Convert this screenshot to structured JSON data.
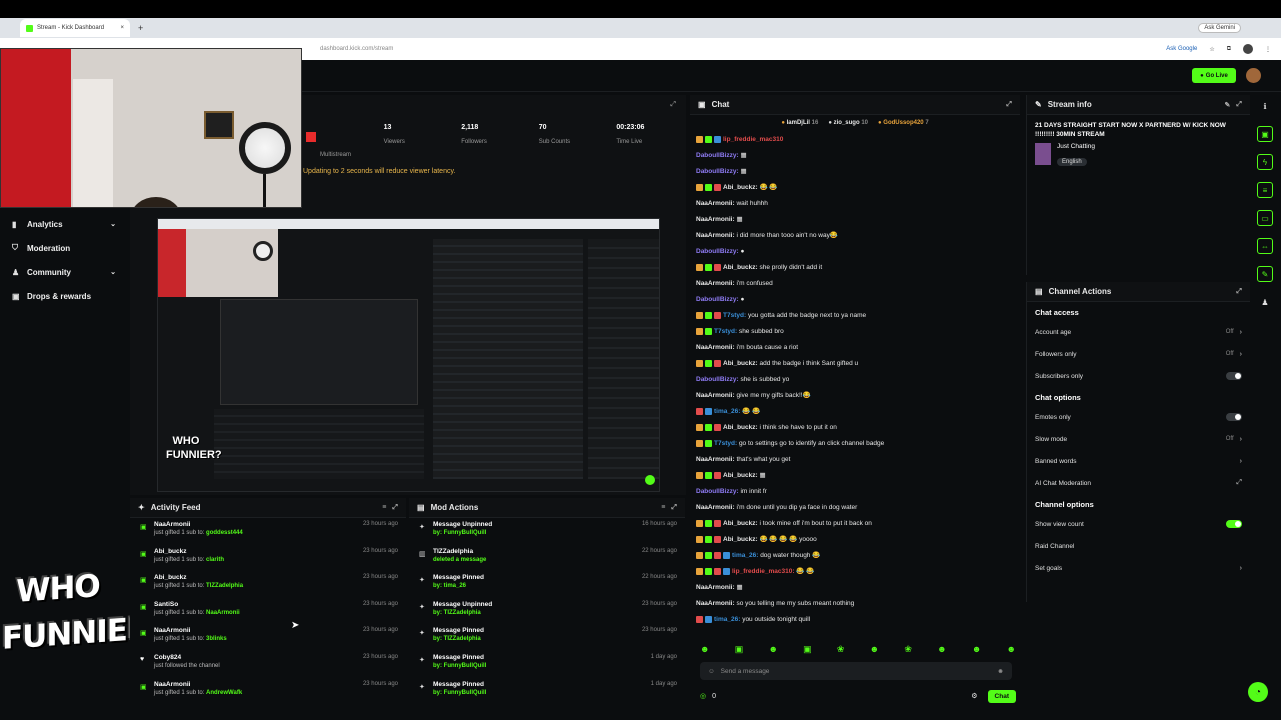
{
  "browser": {
    "tab_title": "Stream - Kick Dashboard",
    "tab_close": "×",
    "new_tab": "+",
    "gemini": "Ask Gemini",
    "url": "dashboard.kick.com/stream",
    "ask_google": "Ask Google"
  },
  "appbar": {
    "go_live": "Go Live"
  },
  "sidebar": {
    "items": [
      {
        "label": "Analytics",
        "icon": "chart-icon",
        "chevron": "⌄"
      },
      {
        "label": "Moderation",
        "icon": "shield-icon"
      },
      {
        "label": "Community",
        "icon": "people-icon",
        "chevron": "⌄"
      },
      {
        "label": "Drops & rewards",
        "icon": "gift-icon"
      }
    ]
  },
  "logo_text": "WHO FUNNIER?",
  "stats": {
    "multistream_label": "Multistream",
    "items": [
      {
        "value": "13",
        "label": "Viewers"
      },
      {
        "value": "2,118",
        "label": "Followers"
      },
      {
        "value": "70",
        "label": "Sub Counts"
      },
      {
        "value": "00:23:06",
        "label": "Time Live"
      }
    ],
    "warning": "Updating to 2 seconds will reduce viewer latency."
  },
  "preview": {
    "logo": "WHO FUNNIER?"
  },
  "activity_feed": {
    "title": "Activity Feed",
    "items": [
      {
        "who": "NaaArmonii",
        "action": "just gifted 1 sub to:",
        "target": "goddesst444",
        "time": "23 hours ago",
        "icon": "gift-icon"
      },
      {
        "who": "Abi_buckz",
        "action": "just gifted 1 sub to:",
        "target": "clarith",
        "time": "23 hours ago",
        "icon": "gift-icon"
      },
      {
        "who": "Abi_buckz",
        "action": "just gifted 1 sub to:",
        "target": "TIZZadelphia",
        "time": "23 hours ago",
        "icon": "gift-icon"
      },
      {
        "who": "SantiSo",
        "action": "just gifted 1 sub to:",
        "target": "NaaArmonii",
        "time": "23 hours ago",
        "icon": "gift-icon"
      },
      {
        "who": "NaaArmonii",
        "action": "just gifted 1 sub to:",
        "target": "3blinks",
        "time": "23 hours ago",
        "icon": "gift-icon"
      },
      {
        "who": "Coby824",
        "action": "just followed the channel",
        "target": "",
        "time": "23 hours ago",
        "icon": "heart-icon"
      },
      {
        "who": "NaaArmonii",
        "action": "just gifted 1 sub to:",
        "target": "AndrewWafk",
        "time": "23 hours ago",
        "icon": "gift-icon"
      }
    ]
  },
  "mod_actions": {
    "title": "Mod Actions",
    "items": [
      {
        "action": "Message Unpinned",
        "by": "by: FunnyBullQuill",
        "time": "16 hours ago",
        "icon": "unpin-icon"
      },
      {
        "action": "TIZZadelphia",
        "by": "deleted a message",
        "time": "22 hours ago",
        "icon": "trash-icon"
      },
      {
        "action": "Message Pinned",
        "by": "by: tima_26",
        "time": "22 hours ago",
        "icon": "pin-icon"
      },
      {
        "action": "Message Unpinned",
        "by": "by: TIZZadelphia",
        "time": "23 hours ago",
        "icon": "unpin-icon"
      },
      {
        "action": "Message Pinned",
        "by": "by: TIZZadelphia",
        "time": "23 hours ago",
        "icon": "pin-icon"
      },
      {
        "action": "Message Pinned",
        "by": "by: FunnyBullQuill",
        "time": "1 day ago",
        "icon": "pin-icon"
      },
      {
        "action": "Message Pinned",
        "by": "by: FunnyBullQuill",
        "time": "1 day ago",
        "icon": "pin-icon"
      }
    ]
  },
  "chat": {
    "title": "Chat",
    "pinned": [
      {
        "name": "IamDjLil",
        "count": "16"
      },
      {
        "name": "zio_sugo",
        "count": "10"
      },
      {
        "name": "GodUssop420",
        "count": "7"
      }
    ],
    "messages": [
      {
        "name": "lip_freddie_mac310",
        "text": "",
        "color": "#e24c4c",
        "badges": [
          "#e8a33b",
          "#53fc18",
          "#3a8fd8"
        ]
      },
      {
        "name": "DaboullBizzy:",
        "text": "▦",
        "color": "#8f7cf5",
        "badges": []
      },
      {
        "name": "DaboullBizzy:",
        "text": "▦",
        "color": "#8f7cf5",
        "badges": []
      },
      {
        "name": "Abi_buckz:",
        "text": "😂 😂",
        "color": "#e8e8e8",
        "badges": [
          "#e8a33b",
          "#53fc18",
          "#e24c4c"
        ]
      },
      {
        "name": "NaaArmonii:",
        "text": "wait huhhh",
        "color": "#e8e8e8",
        "badges": []
      },
      {
        "name": "NaaArmonii:",
        "text": "▦",
        "color": "#e8e8e8",
        "badges": []
      },
      {
        "name": "NaaArmonii:",
        "text": "i did more than tooo ain't no way😂",
        "color": "#e8e8e8",
        "badges": []
      },
      {
        "name": "DaboullBizzy:",
        "text": "●",
        "color": "#8f7cf5",
        "badges": []
      },
      {
        "name": "Abi_buckz:",
        "text": "she prolly didn't add it",
        "color": "#e8e8e8",
        "badges": [
          "#e8a33b",
          "#53fc18",
          "#e24c4c"
        ]
      },
      {
        "name": "NaaArmonii:",
        "text": "i'm confused",
        "color": "#e8e8e8",
        "badges": []
      },
      {
        "name": "DaboullBizzy:",
        "text": "●",
        "color": "#8f7cf5",
        "badges": []
      },
      {
        "name": "T7styd:",
        "text": "you gotta add the badge next to ya name",
        "color": "#3a8fd8",
        "badges": [
          "#e8a33b",
          "#53fc18",
          "#e24c4c"
        ]
      },
      {
        "name": "T7styd:",
        "text": "she subbed bro",
        "color": "#3a8fd8",
        "badges": [
          "#e8a33b",
          "#53fc18"
        ]
      },
      {
        "name": "NaaArmonii:",
        "text": "i'm bouta cause a riot",
        "color": "#e8e8e8",
        "badges": []
      },
      {
        "name": "Abi_buckz:",
        "text": "add the badge i think Sant gifted u",
        "color": "#e8e8e8",
        "badges": [
          "#e8a33b",
          "#53fc18",
          "#e24c4c"
        ]
      },
      {
        "name": "DaboullBizzy:",
        "text": "she is subbed yo",
        "color": "#8f7cf5",
        "badges": []
      },
      {
        "name": "NaaArmonii:",
        "text": "give me my gifts back!!😂",
        "color": "#e8e8e8",
        "badges": []
      },
      {
        "name": "tima_26:",
        "text": "😂 😂",
        "color": "#3a8fd8",
        "badges": [
          "#e24c4c",
          "#3a8fd8"
        ]
      },
      {
        "name": "Abi_buckz:",
        "text": "i think she have to put it on",
        "color": "#e8e8e8",
        "badges": [
          "#e8a33b",
          "#53fc18",
          "#e24c4c"
        ]
      },
      {
        "name": "T7styd:",
        "text": "go to settings go to identify an click channel badge",
        "color": "#3a8fd8",
        "badges": [
          "#e8a33b",
          "#53fc18"
        ]
      },
      {
        "name": "NaaArmonii:",
        "text": "that's what you get",
        "color": "#e8e8e8",
        "badges": []
      },
      {
        "name": "Abi_buckz:",
        "text": "▦",
        "color": "#e8e8e8",
        "badges": [
          "#e8a33b",
          "#53fc18",
          "#e24c4c"
        ]
      },
      {
        "name": "DaboullBizzy:",
        "text": "im innit fr",
        "color": "#8f7cf5",
        "badges": []
      },
      {
        "name": "NaaArmonii:",
        "text": "i'm done until you dip ya face in dog water",
        "color": "#e8e8e8",
        "badges": []
      },
      {
        "name": "Abi_buckz:",
        "text": "i took mine off i'm bout to put it back on",
        "color": "#e8e8e8",
        "badges": [
          "#e8a33b",
          "#53fc18",
          "#e24c4c"
        ]
      },
      {
        "name": "Abi_buckz:",
        "text": "😂 😂 😂 😂 yoooo",
        "color": "#e8e8e8",
        "badges": [
          "#e8a33b",
          "#53fc18",
          "#e24c4c"
        ]
      },
      {
        "name": "tima_26:",
        "text": "dog water though 😂",
        "color": "#3a8fd8",
        "badges": [
          "#e8a33b",
          "#53fc18",
          "#e24c4c",
          "#3a8fd8"
        ]
      },
      {
        "name": "lip_freddie_mac310:",
        "text": "😂 😂",
        "color": "#e24c4c",
        "badges": [
          "#e8a33b",
          "#53fc18",
          "#e24c4c",
          "#3a8fd8"
        ]
      },
      {
        "name": "NaaArmonii:",
        "text": "▦",
        "color": "#e8e8e8",
        "badges": []
      },
      {
        "name": "NaaArmonii:",
        "text": "so you telling me my subs meant nothing",
        "color": "#e8e8e8",
        "badges": []
      },
      {
        "name": "tima_26:",
        "text": "you outside tonight quill",
        "color": "#3a8fd8",
        "badges": [
          "#e24c4c",
          "#3a8fd8"
        ]
      }
    ],
    "input_placeholder": "Send a message",
    "count": "0",
    "send_label": "Chat",
    "emotes": [
      "☻",
      "▣",
      "☻",
      "▣",
      "❀",
      "☻",
      "❀",
      "☻",
      "☻",
      "☻"
    ]
  },
  "stream_info": {
    "title": "Stream info",
    "stream_title": "21 DAYS STRAIGHT START NOW X PARTNERD W/ KICK NOW !!!!!!!!! 30MIN STREAM",
    "category": "Just Chatting",
    "language": "English"
  },
  "channel_actions": {
    "title": "Channel Actions",
    "chat_access": "Chat access",
    "account_age": {
      "label": "Account age",
      "value": "Off"
    },
    "followers_only": {
      "label": "Followers only",
      "value": "Off"
    },
    "subscribers_only": "Subscribers only",
    "chat_options": "Chat options",
    "emotes_only": "Emotes only",
    "slow_mode": {
      "label": "Slow mode",
      "value": "Off"
    },
    "banned_words": "Banned words",
    "ai_moderation": "AI Chat Moderation",
    "channel_options": "Channel options",
    "show_view_count": "Show view count",
    "raid_channel": "Raid Channel",
    "set_goals": "Set goals"
  },
  "colors": {
    "accent": "#53fc18",
    "bg": "#0b0d0f"
  }
}
